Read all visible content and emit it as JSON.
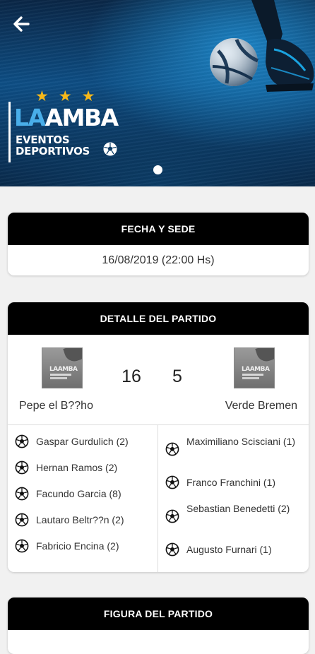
{
  "header": {
    "logo": {
      "part1": "LA",
      "part2": "AMBA",
      "subtitle_line1": "EVENTOS",
      "subtitle_line2": "DEPORTIVOS"
    },
    "stars": [
      "★",
      "★",
      "★"
    ]
  },
  "fecha": {
    "title": "FECHA Y SEDE",
    "value": "16/08/2019 (22:00 Hs)"
  },
  "detalle": {
    "title": "DETALLE DEL PARTIDO",
    "home": {
      "name": "Pepe el B??ho",
      "score": "16"
    },
    "away": {
      "name": "Verde Bremen",
      "score": "5"
    },
    "home_scorers": [
      {
        "name": "Gaspar Gurdulich (2)"
      },
      {
        "name": "Hernan Ramos (2)"
      },
      {
        "name": "Facundo Garcia (8)"
      },
      {
        "name": "Lautaro Beltr??n (2)"
      },
      {
        "name": "Fabricio Encina (2)"
      }
    ],
    "away_scorers": [
      {
        "name": "Maximiliano Scisciani (1)"
      },
      {
        "name": "Franco Franchini (1)"
      },
      {
        "name": "Sebastian Benedetti (2)"
      },
      {
        "name": "Augusto Furnari (1)"
      }
    ]
  },
  "figura": {
    "title": "FIGURA DEL PARTIDO"
  },
  "colors": {
    "accent": "#49aee9",
    "star": "#f6b81a",
    "header_bg": "#000000"
  },
  "icons": {
    "back": "arrow-left-icon",
    "scorer": "soccer-ball-icon"
  }
}
